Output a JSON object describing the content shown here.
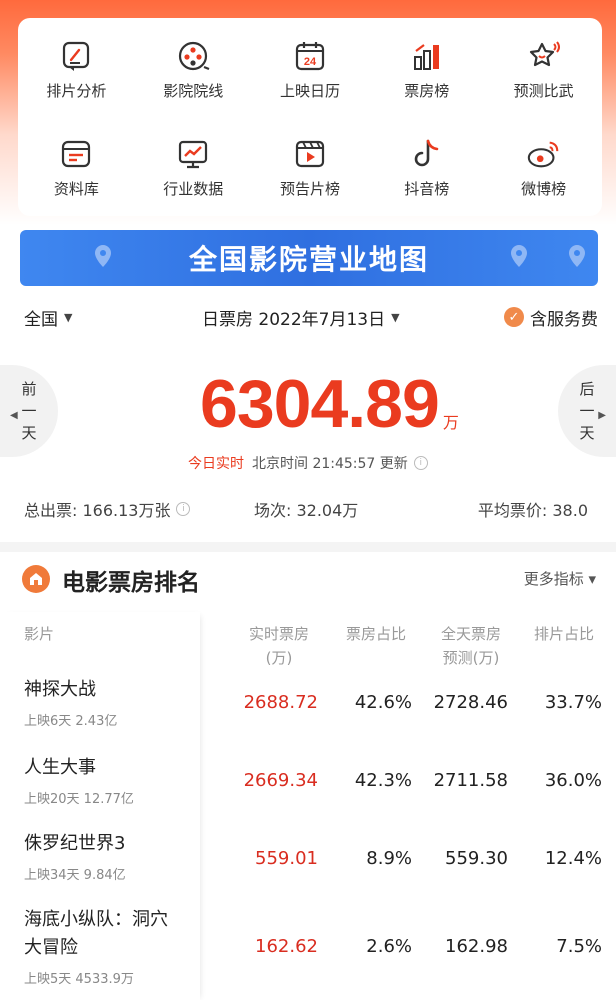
{
  "colors": {
    "accent": "#ea3b1f",
    "banner": "#2f6fe0",
    "check": "#f08a4b"
  },
  "grid": [
    {
      "label": "排片分析",
      "icon": "edit-doc-icon"
    },
    {
      "label": "影院院线",
      "icon": "film-reel-icon"
    },
    {
      "label": "上映日历",
      "icon": "calendar-24-icon"
    },
    {
      "label": "票房榜",
      "icon": "bar-chart-icon"
    },
    {
      "label": "预测比武",
      "icon": "trophy-icon"
    },
    {
      "label": "资料库",
      "icon": "database-icon"
    },
    {
      "label": "行业数据",
      "icon": "trend-screen-icon"
    },
    {
      "label": "预告片榜",
      "icon": "video-play-icon"
    },
    {
      "label": "抖音榜",
      "icon": "douyin-icon"
    },
    {
      "label": "微博榜",
      "icon": "weibo-icon"
    }
  ],
  "banner": {
    "text": "全国影院营业地图"
  },
  "filters": {
    "region": "全国",
    "date": "日票房 2022年7月13日",
    "fee": "含服务费"
  },
  "nav": {
    "prev": [
      "前",
      "一",
      "天"
    ],
    "next": [
      "后",
      "一",
      "天"
    ]
  },
  "boxoffice": {
    "value": "6304.89",
    "unit": "万"
  },
  "update": {
    "live": "今日实时",
    "time": "北京时间 21:45:57 更新"
  },
  "stats": {
    "tickets": "总出票: 166.13万张",
    "sessions": "场次: 32.04万",
    "avg_price": "平均票价: 38.0"
  },
  "ranking": {
    "title": "电影票房排名",
    "more": "更多指标 ▾",
    "headers": {
      "film": "影片",
      "realtime": [
        "实时票房",
        "(万)"
      ],
      "share": "票房占比",
      "forecast": [
        "全天票房",
        "预测(万)"
      ],
      "schedule": "排片占比"
    },
    "rows": [
      {
        "name": [
          "神探大战"
        ],
        "sub": "上映6天 2.43亿",
        "realtime": "2688.72",
        "share": "42.6%",
        "forecast": "2728.46",
        "schedule": "33.7%"
      },
      {
        "name": [
          "人生大事"
        ],
        "sub": "上映20天 12.77亿",
        "realtime": "2669.34",
        "share": "42.3%",
        "forecast": "2711.58",
        "schedule": "36.0%"
      },
      {
        "name": [
          "侏罗纪世界3"
        ],
        "sub": "上映34天 9.84亿",
        "realtime": "559.01",
        "share": "8.9%",
        "forecast": "559.30",
        "schedule": "12.4%"
      },
      {
        "name": [
          "海底小纵队：洞穴",
          "大冒险"
        ],
        "sub": "上映5天 4533.9万",
        "realtime": "162.62",
        "share": "2.6%",
        "forecast": "162.98",
        "schedule": "7.5%"
      }
    ]
  }
}
